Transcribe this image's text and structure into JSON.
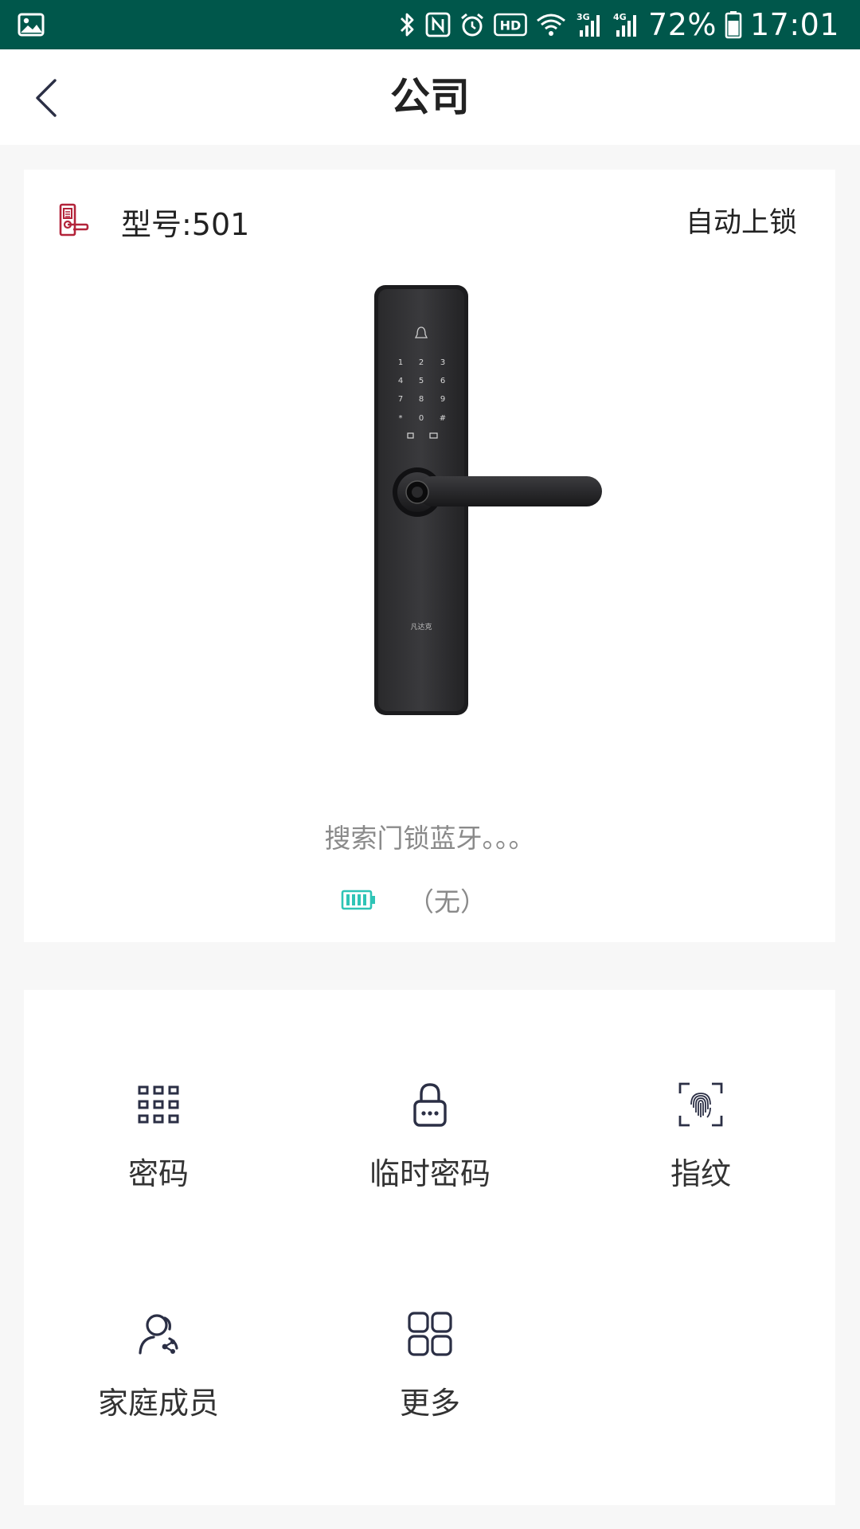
{
  "status_bar": {
    "battery_percent": "72%",
    "time": "17:01",
    "icons": [
      "gallery-icon",
      "bluetooth-icon",
      "nfc-icon",
      "alarm-icon",
      "hd-icon",
      "wifi-icon",
      "signal-3g-icon",
      "signal-4g-icon",
      "battery-icon"
    ],
    "hd_label": "HD",
    "net_3g": "3G",
    "net_4g": "4G"
  },
  "header": {
    "title": "公司",
    "back_icon": "chevron-left-icon"
  },
  "lock_card": {
    "model_label": "型号:501",
    "auto_lock_label": "自动上锁",
    "search_status": "搜索门锁蓝牙。。。",
    "battery_text": "（无）",
    "brand_mark": "凡达克"
  },
  "features": [
    {
      "label": "密码",
      "icon": "keypad-icon"
    },
    {
      "label": "临时密码",
      "icon": "padlock-icon"
    },
    {
      "label": "指纹",
      "icon": "fingerprint-icon"
    },
    {
      "label": "家庭成员",
      "icon": "family-members-icon"
    },
    {
      "label": "更多",
      "icon": "grid-more-icon"
    }
  ],
  "colors": {
    "status_bar": "#00574b",
    "accent_teal": "#2ec4b6",
    "model_icon_red": "#b3243a",
    "icon_navy": "#2b2f45"
  }
}
